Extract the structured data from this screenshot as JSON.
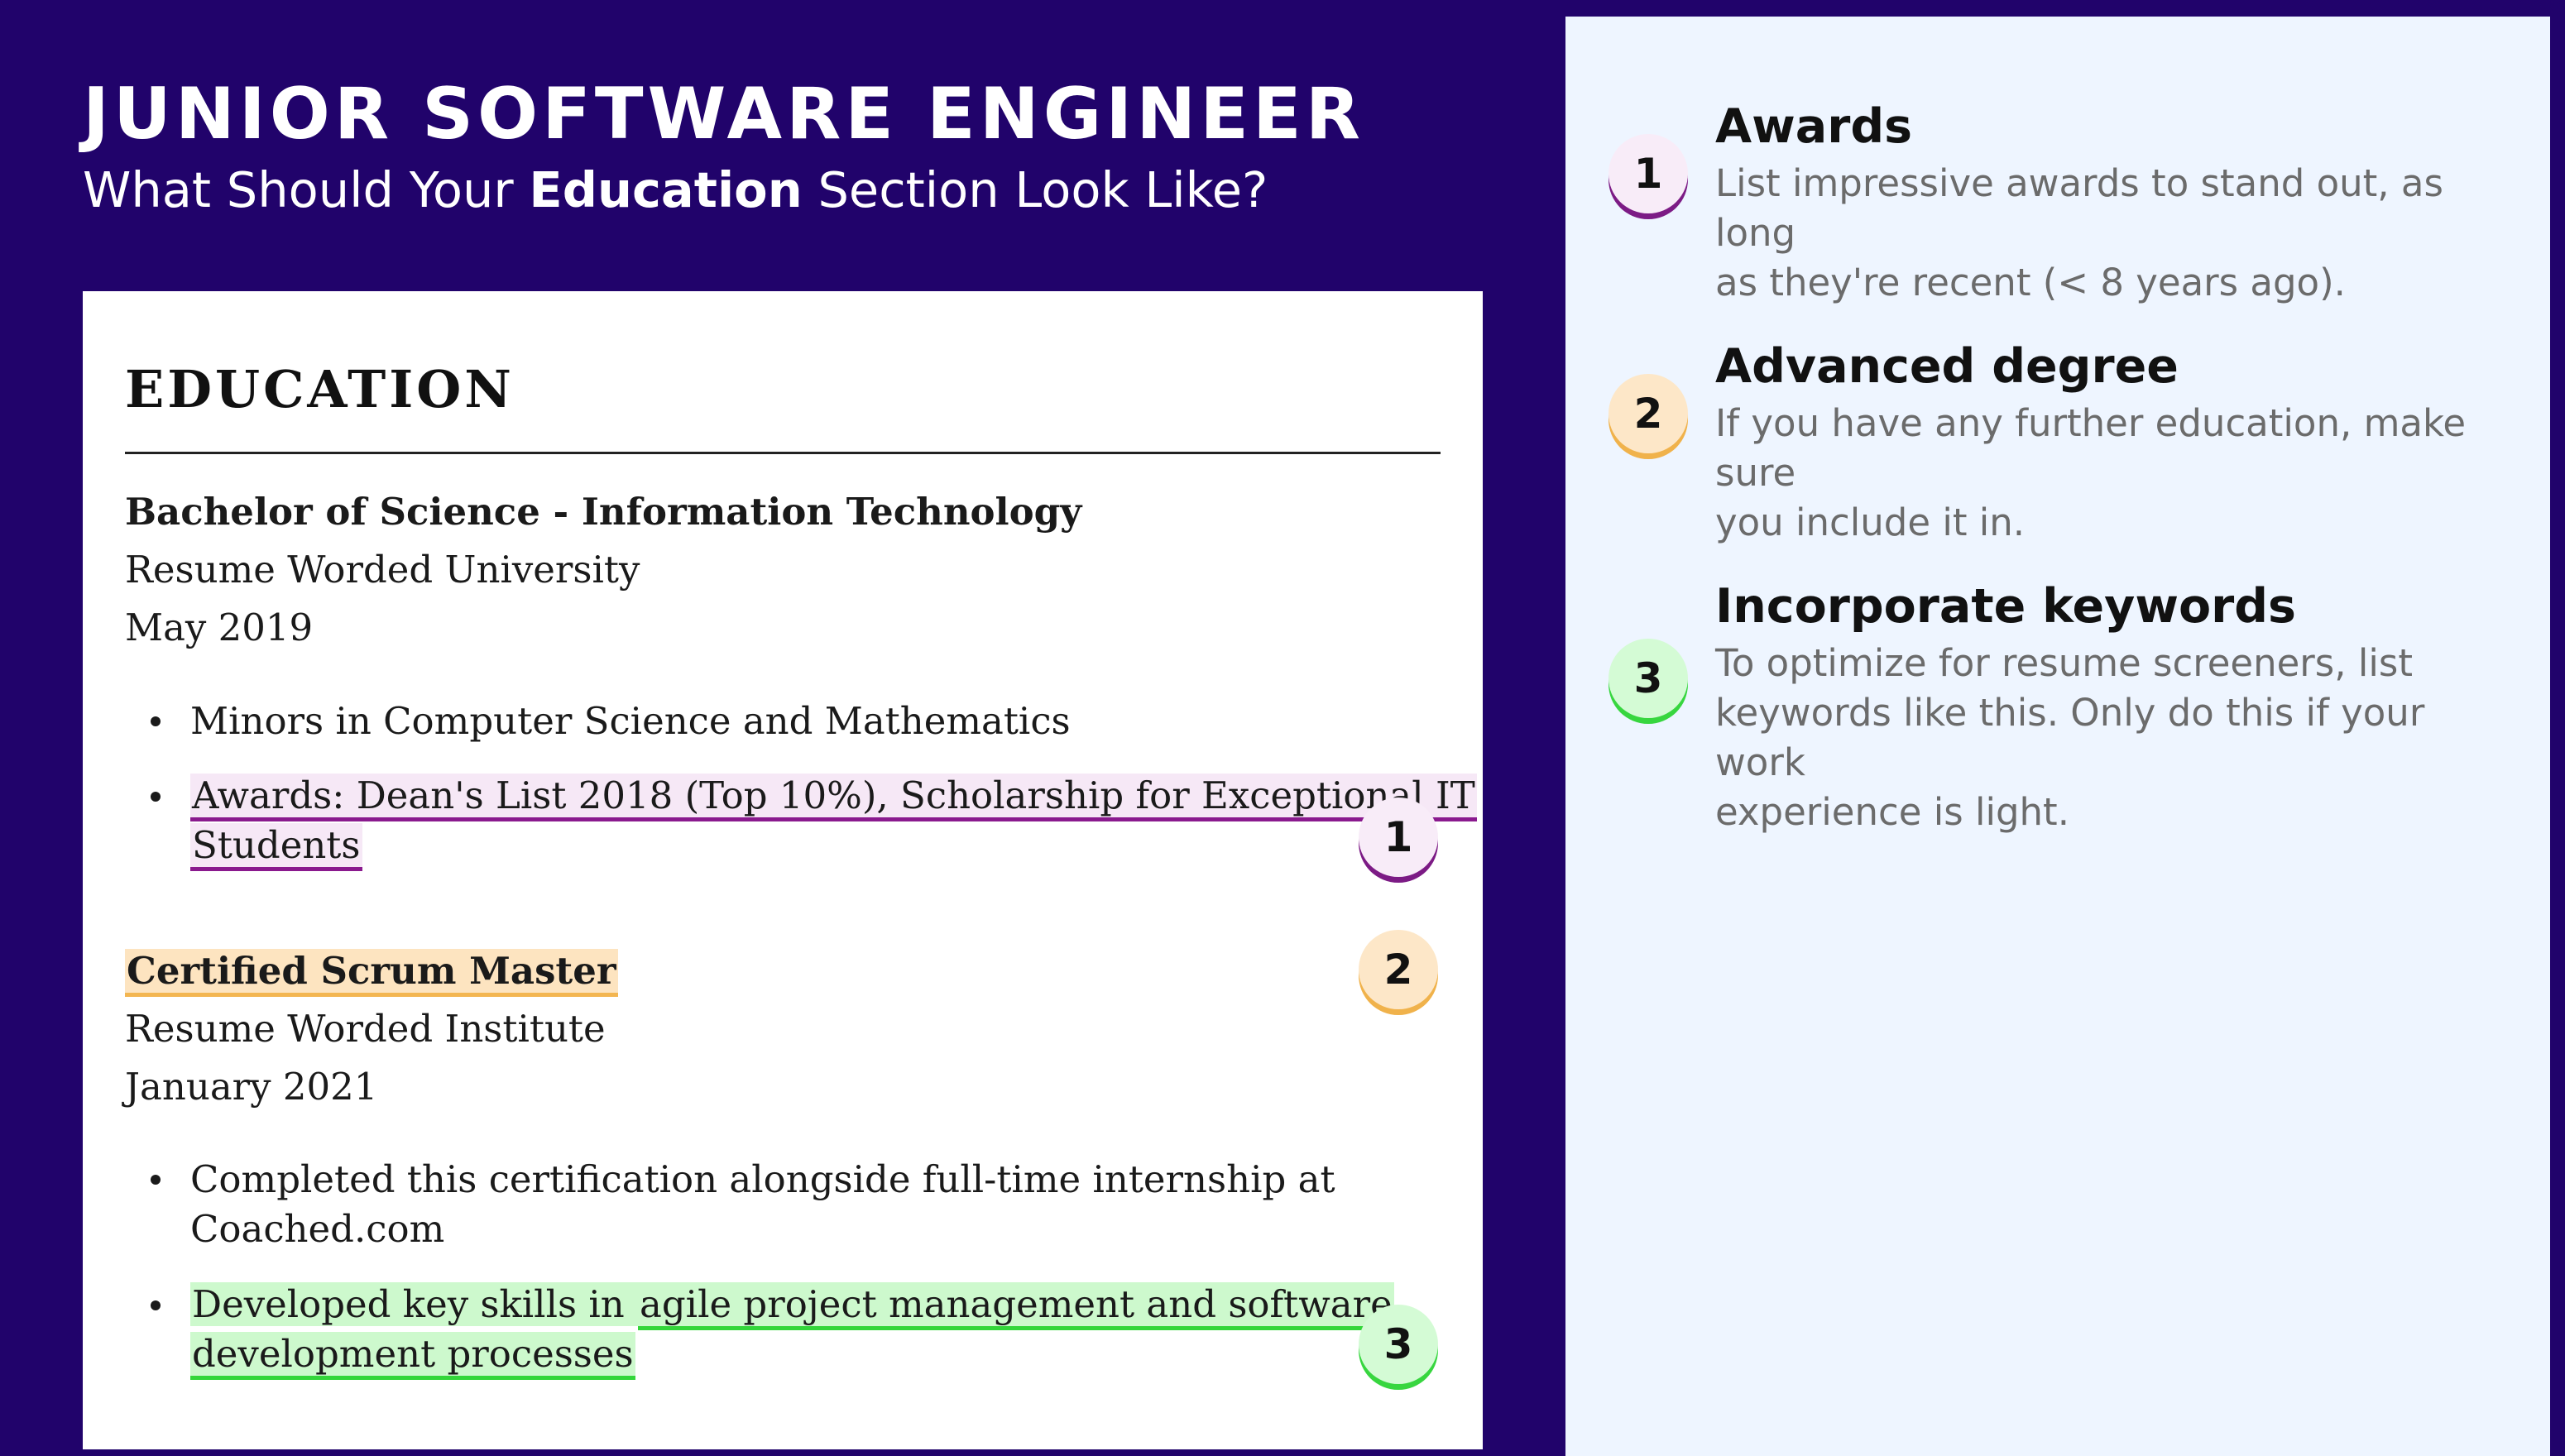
{
  "header": {
    "title": "JUNIOR SOFTWARE ENGINEER",
    "subtitle_pre": "What Should Your ",
    "subtitle_bold": "Education",
    "subtitle_post": " Section Look Like?"
  },
  "resume": {
    "section_title": "EDUCATION",
    "entries": [
      {
        "degree": "Bachelor of Science - Information Technology",
        "institution": "Resume Worded University",
        "date": "May 2019",
        "bullets": [
          {
            "text": "Minors in Computer Science and Mathematics"
          },
          {
            "line1": "Awards: Dean's List 2018 (Top 10%), Scholarship for Exceptional IT",
            "line2": "Students"
          }
        ]
      },
      {
        "degree": "Certified Scrum Master",
        "institution": "Resume Worded Institute",
        "date": "January 2021",
        "bullets": [
          {
            "line1": "Completed this certification alongside full-time internship at",
            "line2": "Coached.com"
          },
          {
            "line1_plain": "Developed key skills in ",
            "line1_hl": "agile project management and software",
            "line2": "development processes"
          }
        ]
      }
    ]
  },
  "badges": [
    "1",
    "2",
    "3"
  ],
  "tips": [
    {
      "number": "1",
      "title": "Awards",
      "line1": "List impressive awards to stand out, as long",
      "line2": "as they're recent (< 8 years ago)."
    },
    {
      "number": "2",
      "title": "Advanced degree",
      "line1": "If you have any further education, make sure",
      "line2": "you include it in."
    },
    {
      "number": "3",
      "title": "Incorporate keywords",
      "line1": "To optimize for resume screeners, list",
      "line2": "keywords like this. Only do this if your work",
      "line3": "experience is light."
    }
  ],
  "colors": {
    "background": "#21036b",
    "tips_panel": "#eef5ff",
    "purple": "#8a1a8e",
    "orange": "#f3b651",
    "green": "#33d63a"
  }
}
